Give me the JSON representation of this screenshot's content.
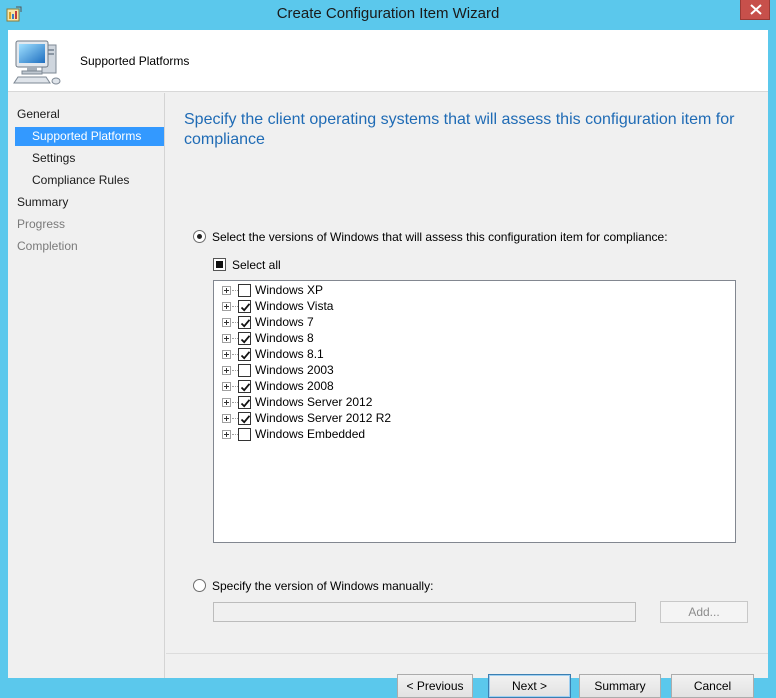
{
  "window": {
    "title": "Create Configuration Item Wizard"
  },
  "header": {
    "title": "Supported Platforms",
    "icon": "computer-monitor-icon"
  },
  "sidebar": {
    "items": [
      {
        "label": "General",
        "state": "normal"
      },
      {
        "label": "Supported Platforms",
        "state": "selected"
      },
      {
        "label": "Settings",
        "state": "normal"
      },
      {
        "label": "Compliance Rules",
        "state": "normal"
      },
      {
        "label": "Summary",
        "state": "normal"
      },
      {
        "label": "Progress",
        "state": "disabled"
      },
      {
        "label": "Completion",
        "state": "disabled"
      }
    ]
  },
  "main": {
    "heading": "Specify the client operating systems that will assess this configuration item for compliance",
    "option_versions": {
      "label": "Select the versions of Windows that will assess this configuration item for compliance:",
      "selected": true
    },
    "select_all": {
      "label": "Select all",
      "state": "indeterminate"
    },
    "platforms": [
      {
        "label": "Windows XP",
        "checked": false
      },
      {
        "label": "Windows Vista",
        "checked": true
      },
      {
        "label": "Windows 7",
        "checked": true
      },
      {
        "label": "Windows 8",
        "checked": true
      },
      {
        "label": "Windows 8.1",
        "checked": true
      },
      {
        "label": "Windows 2003",
        "checked": false
      },
      {
        "label": "Windows 2008",
        "checked": true
      },
      {
        "label": "Windows Server 2012",
        "checked": true
      },
      {
        "label": "Windows Server 2012 R2",
        "checked": true
      },
      {
        "label": "Windows Embedded",
        "checked": false
      }
    ],
    "option_manual": {
      "label": "Specify the version of Windows manually:",
      "selected": false,
      "value": ""
    },
    "add_button": "Add..."
  },
  "footer": {
    "previous": "< Previous",
    "next": "Next >",
    "summary": "Summary",
    "cancel": "Cancel"
  },
  "colors": {
    "window_border": "#5bc8ec",
    "selection": "#3399ff",
    "heading": "#1f6bb5",
    "close_button": "#c7504b"
  }
}
